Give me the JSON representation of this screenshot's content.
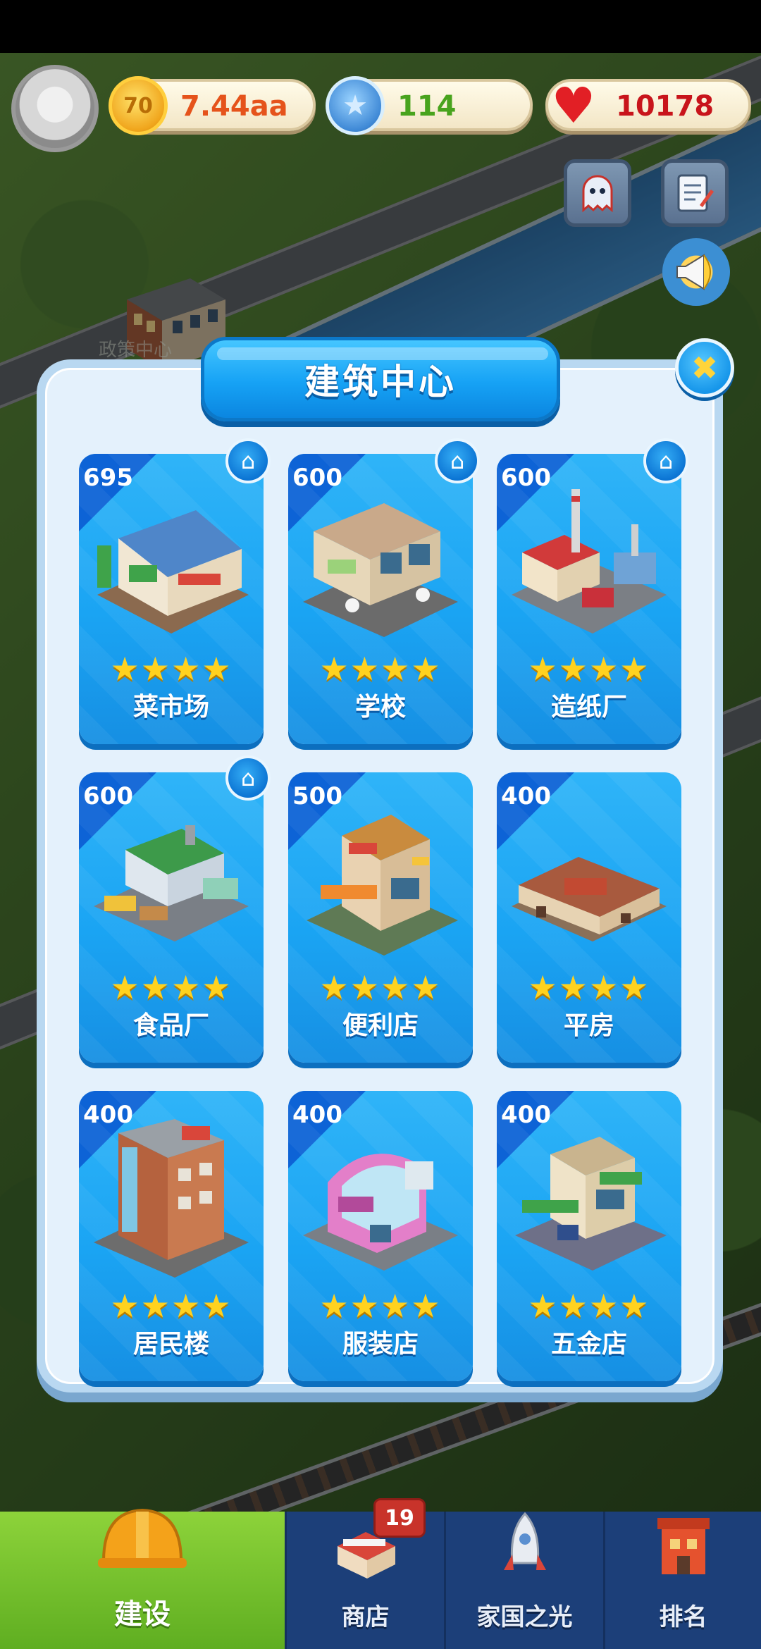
{
  "hud": {
    "coins": "7.44aa",
    "coin_icon_text": "70",
    "gems": "114",
    "hearts": "10178",
    "colors": {
      "coins": "#e5531b",
      "gems": "#48a31d",
      "hearts": "#c8141b"
    }
  },
  "map": {
    "bg_label": "政策中心"
  },
  "modal": {
    "title": "建筑中心",
    "buildings": [
      {
        "price": "695",
        "name": "菜市场",
        "stars": "★★★★",
        "home": true
      },
      {
        "price": "600",
        "name": "学校",
        "stars": "★★★★",
        "home": true
      },
      {
        "price": "600",
        "name": "造纸厂",
        "stars": "★★★★",
        "home": true
      },
      {
        "price": "600",
        "name": "食品厂",
        "stars": "★★★★",
        "home": true
      },
      {
        "price": "500",
        "name": "便利店",
        "stars": "★★★★",
        "home": false
      },
      {
        "price": "400",
        "name": "平房",
        "stars": "★★★★",
        "home": false
      },
      {
        "price": "400",
        "name": "居民楼",
        "stars": "★★★★",
        "home": false
      },
      {
        "price": "400",
        "name": "服装店",
        "stars": "★★★★",
        "home": false
      },
      {
        "price": "400",
        "name": "五金店",
        "stars": "★★★★",
        "home": false
      }
    ]
  },
  "nav": {
    "items": [
      {
        "label": "建设",
        "icon": "hard-hat-icon",
        "active": true
      },
      {
        "label": "商店",
        "icon": "shop-icon",
        "active": false
      },
      {
        "label": "家国之光",
        "icon": "rocket-icon",
        "active": false
      },
      {
        "label": "排名",
        "icon": "ranking-building-icon",
        "active": false
      }
    ],
    "shop_badge": "19"
  }
}
